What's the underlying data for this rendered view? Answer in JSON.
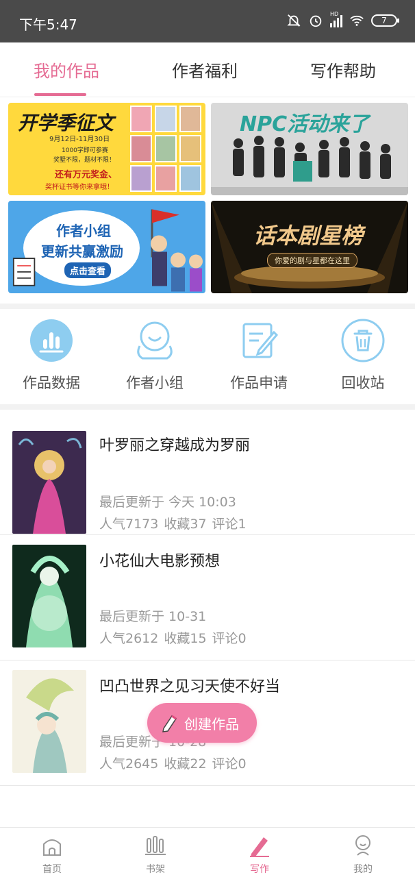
{
  "status_bar": {
    "time": "下午5:47",
    "battery": "7",
    "network_badge": "HD"
  },
  "tabs": [
    {
      "label": "我的作品",
      "active": true
    },
    {
      "label": "作者福利",
      "active": false
    },
    {
      "label": "写作帮助",
      "active": false
    }
  ],
  "banners": [
    {
      "title": "开学季征文",
      "line1": "9月12日-11月30日",
      "line2": "1000字即可参赛",
      "line3": "奖墅不限，题材不限！",
      "line4": "还有万元奖金、",
      "line5": "奖杯证书等你来拿哦！",
      "colors": {
        "bg": "#ffd93d",
        "title": "#1a1a1a"
      }
    },
    {
      "title": "NPC活动来了",
      "colors": {
        "bg": "#d9d9d9",
        "title": "#2aa39a"
      }
    },
    {
      "title": "作者小组",
      "line2": "更新共赢激励",
      "button": "点击查看",
      "colors": {
        "bg": "#4ea6e8",
        "title": "#1e64b4"
      }
    },
    {
      "title": "话本剧星榜",
      "subtitle": "你爱的剧与星都在这里",
      "colors": {
        "bg": "#15120c",
        "title": "#f1c88b"
      }
    }
  ],
  "functions": [
    {
      "label": "作品数据",
      "icon": "bar-chart-icon"
    },
    {
      "label": "作者小组",
      "icon": "group-icon"
    },
    {
      "label": "作品申请",
      "icon": "edit-document-icon"
    },
    {
      "label": "回收站",
      "icon": "trash-icon"
    }
  ],
  "works": [
    {
      "title": "叶罗丽之穿越成为罗丽",
      "updated": "最后更新于 今天 10:03",
      "popularity": "人气7173",
      "favorites": "收藏37",
      "comments": "评论1"
    },
    {
      "title": "小花仙大电影预想",
      "updated": "最后更新于 10-31",
      "popularity": "人气2612",
      "favorites": "收藏15",
      "comments": "评论0"
    },
    {
      "title": "凹凸世界之见习天使不好当",
      "updated": "最后更新于 10-28",
      "popularity": "人气2645",
      "favorites": "收藏22",
      "comments": "评论0"
    }
  ],
  "fab": {
    "label": "创建作品",
    "icon": "pencil-icon"
  },
  "bottom_nav": [
    {
      "label": "首页",
      "icon": "home-icon",
      "active": false
    },
    {
      "label": "书架",
      "icon": "bookshelf-icon",
      "active": false
    },
    {
      "label": "写作",
      "icon": "pen-icon",
      "active": true
    },
    {
      "label": "我的",
      "icon": "profile-icon",
      "active": false
    }
  ],
  "colors": {
    "accent": "#e56b93",
    "icon_blue": "#8ecdf0",
    "fab": "#f27fa8"
  }
}
